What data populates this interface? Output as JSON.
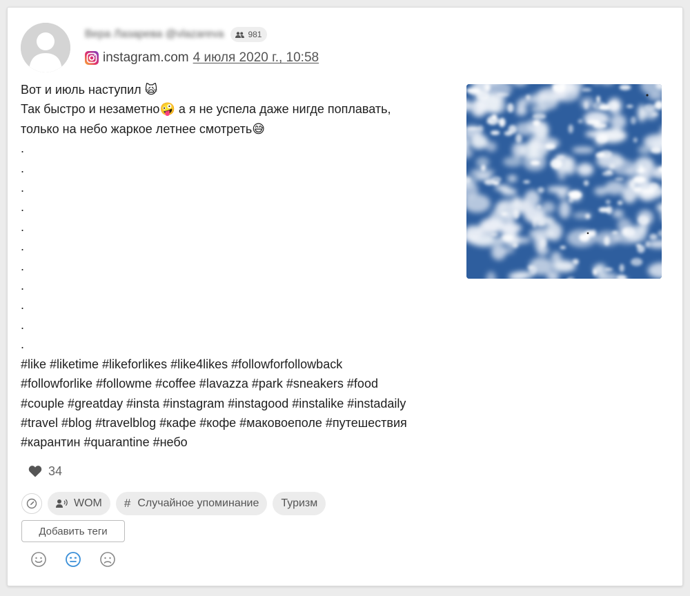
{
  "post": {
    "author_name": "Вера Лазарева @vlazareva",
    "followers_count": "981",
    "source": "instagram.com",
    "date": "4 июля 2020 г., 10:58",
    "text_lines": [
      "Вот и июль наступил 🙀",
      "Так быстро и незаметно🤪 а я не успела даже нигде поплавать,",
      "только на небо жаркое летнее смотреть😅",
      ".",
      ".",
      ".",
      ".",
      ".",
      ".",
      ".",
      ".",
      ".",
      ".",
      ".",
      "#like #liketime #likeforlikes #like4likes #followforfollowback",
      "#followforlike #followme #coffee #lavazza #park #sneakers #food",
      "#couple #greatday #insta #instagram #instagood #instalike #instadaily",
      "#travel #blog #travelblog #кафе #кофе #маковоеполе #путешествия",
      "#карантин #quarantine #небо"
    ],
    "likes": "34"
  },
  "tags": {
    "items": [
      "WOM",
      "Случайное упоминание",
      "Туризм"
    ],
    "add_label": "Добавить теги"
  },
  "sentiment": {
    "options": [
      "positive-icon",
      "neutral-icon",
      "negative-icon"
    ],
    "selected": "neutral",
    "selected_color": "#3a8fd8",
    "default_color": "#888888"
  },
  "colors": {
    "chip_bg": "#ececec",
    "sky_blue": "#2f5f9c"
  }
}
